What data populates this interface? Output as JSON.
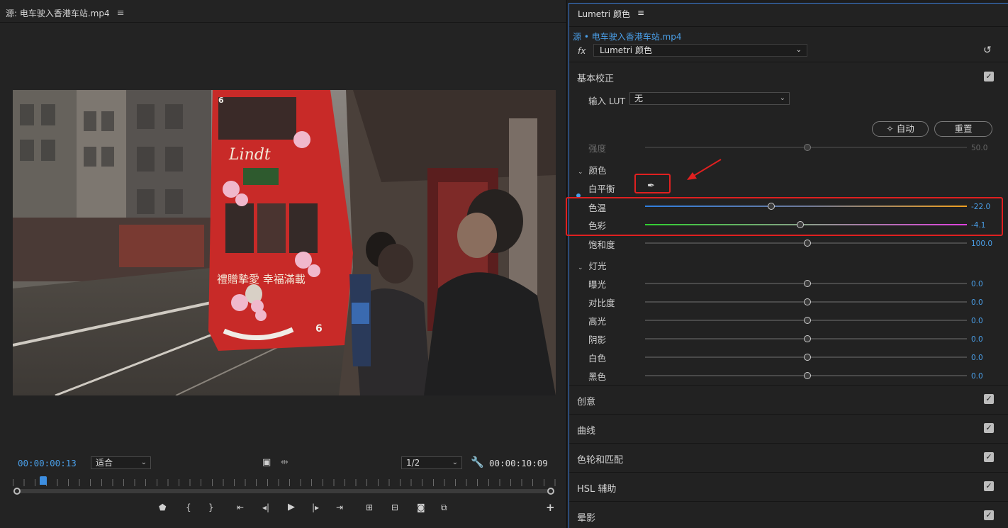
{
  "source_monitor": {
    "tab_title": "源: 电车驶入香港车站.mp4",
    "menu_glyph": "≡",
    "timecode_current": "00:00:00:13",
    "timecode_duration": "00:00:10:09",
    "fit_dropdown": "适合",
    "resolution_dropdown": "1/2",
    "playhead_fraction": 0.05
  },
  "lumetri": {
    "tab_title": "Lumetri 颜色",
    "menu_glyph": "≡",
    "clip_source": "源 • 电车驶入香港车站.mp4",
    "fx_label": "fx",
    "effect_name": "Lumetri 颜色",
    "basic": {
      "title": "基本校正",
      "input_lut_label": "输入 LUT",
      "input_lut_value": "无",
      "auto_label": "自动",
      "reset_label": "重置",
      "intensity_label": "强度",
      "intensity_value": "50.0",
      "color_title": "颜色",
      "white_balance_label": "白平衡",
      "temperature_label": "色温",
      "temperature_value": "-22.0",
      "tint_label": "色彩",
      "tint_value": "-4.1",
      "saturation_label": "饱和度",
      "saturation_value": "100.0",
      "light_title": "灯光",
      "exposure_label": "曝光",
      "exposure_value": "0.0",
      "contrast_label": "对比度",
      "contrast_value": "0.0",
      "highlights_label": "高光",
      "highlights_value": "0.0",
      "shadows_label": "阴影",
      "shadows_value": "0.0",
      "whites_label": "白色",
      "whites_value": "0.0",
      "blacks_label": "黑色",
      "blacks_value": "0.0"
    },
    "sections": [
      "创意",
      "曲线",
      "色轮和匹配",
      "HSL 辅助",
      "晕影"
    ]
  },
  "colors": {
    "accent_blue": "#4a9fe8",
    "annotation_red": "#e02020",
    "temp_gradient": [
      "#2f7fe0",
      "#f0a020"
    ],
    "tint_gradient": [
      "#30d030",
      "#e040e0"
    ]
  },
  "icons": [
    "fit-frame-icon",
    "trim-icon",
    "wrench-icon",
    "marker-icon",
    "mark-in-icon",
    "mark-out-icon",
    "go-to-in-icon",
    "step-back-icon",
    "play-icon",
    "step-forward-icon",
    "go-to-out-icon",
    "insert-icon",
    "overwrite-icon",
    "export-frame-icon",
    "compare-icon",
    "add-button-icon",
    "eyedropper-icon",
    "reset-effect-icon",
    "magic-wand-icon"
  ]
}
